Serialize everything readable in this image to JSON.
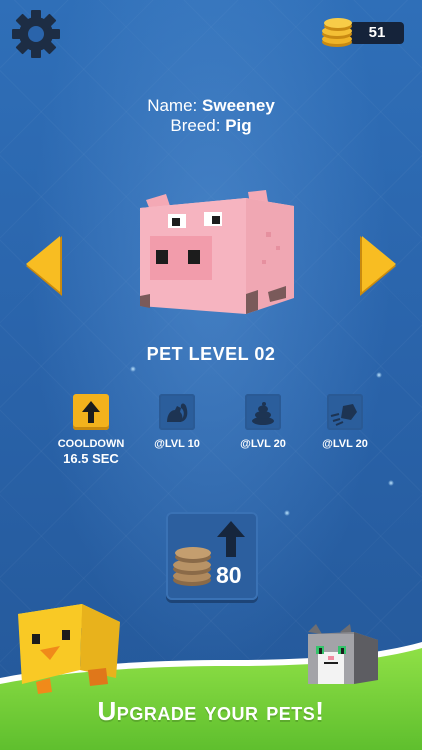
{
  "coins": "51",
  "pet": {
    "name_label": "Name:",
    "name": "Sweeney",
    "breed_label": "Breed:",
    "breed": "Pig"
  },
  "level": "PET LEVEL 02",
  "skills": [
    {
      "icon": "up-arrow-icon",
      "label": "COOLDOWN",
      "value": "16.5 SEC",
      "locked": false
    },
    {
      "icon": "squirrel-icon",
      "label": "@LVL 10",
      "locked": true
    },
    {
      "icon": "poop-icon",
      "label": "@LVL 20",
      "locked": true
    },
    {
      "icon": "fast-rock-icon",
      "label": "@LVL 20",
      "locked": true
    }
  ],
  "upgrade": {
    "price": "80"
  },
  "banner": "Upgrade your pets!",
  "colors": {
    "accent": "#f3b21c",
    "background": "#2a64ab",
    "banner_green": "#7fd93f"
  }
}
